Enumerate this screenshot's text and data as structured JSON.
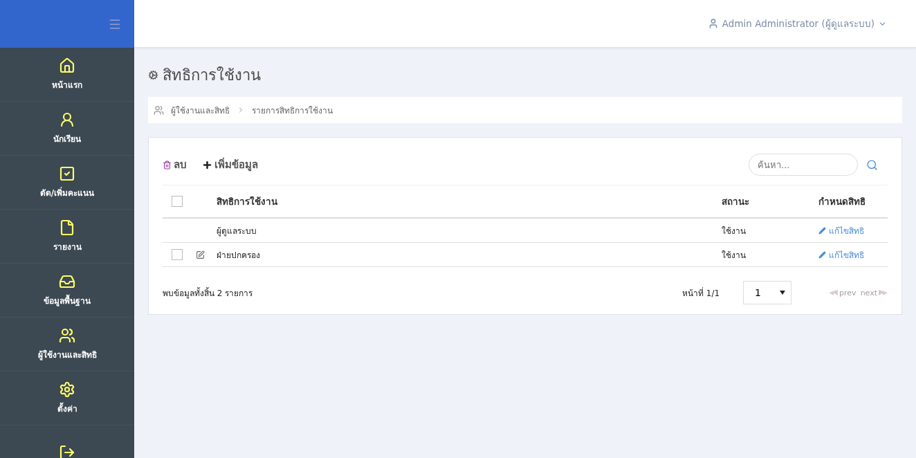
{
  "topbar": {
    "user": "Admin Administrator (ผู้ดูแลระบบ)"
  },
  "sidebar": {
    "items": [
      {
        "label": "หน้าแรก"
      },
      {
        "label": "นักเรียน"
      },
      {
        "label": "ตัด/เพิ่มคะแนน"
      },
      {
        "label": "รายงาน"
      },
      {
        "label": "ข้อมูลพื้นฐาน"
      },
      {
        "label": "ผู้ใช้งานและสิทธิ"
      },
      {
        "label": "ตั้งค่า"
      },
      {
        "kind": "icon_only"
      }
    ]
  },
  "page_title": "สิทธิการใช้งาน",
  "breadcrumb": [
    "ผู้ใช้งานและสิทธิ",
    "รายการสิทธิการใช้งาน"
  ],
  "toolbar": {
    "delete": "ลบ",
    "add": "เพิ่มข้อมูล",
    "search": {
      "placeholder": "ค้นหา..."
    }
  },
  "table": {
    "columns": [
      "สิทธิการใช้งาน",
      "สถานะ",
      "กำหนดสิทธิ"
    ],
    "header_checked": false,
    "rows": [
      {
        "kind": "locked",
        "name": "ผู้ดูแลระบบ",
        "status": "ใช้งาน",
        "action": "แก้ไขสิทธิ"
      },
      {
        "kind": "editable",
        "checked": false,
        "name": "ฝ่ายปกครอง",
        "status": "ใช้งาน",
        "action": "แก้ไขสิทธิ"
      }
    ]
  },
  "footer": {
    "summary": "พบข้อมูลทั้งสิ้น 2 รายการ",
    "page_label": "หน้าที่ 1/1",
    "page_select": "1",
    "prev": {
      "label": "prev",
      "disabled": true
    },
    "next": {
      "label": "next",
      "disabled": true
    }
  }
}
